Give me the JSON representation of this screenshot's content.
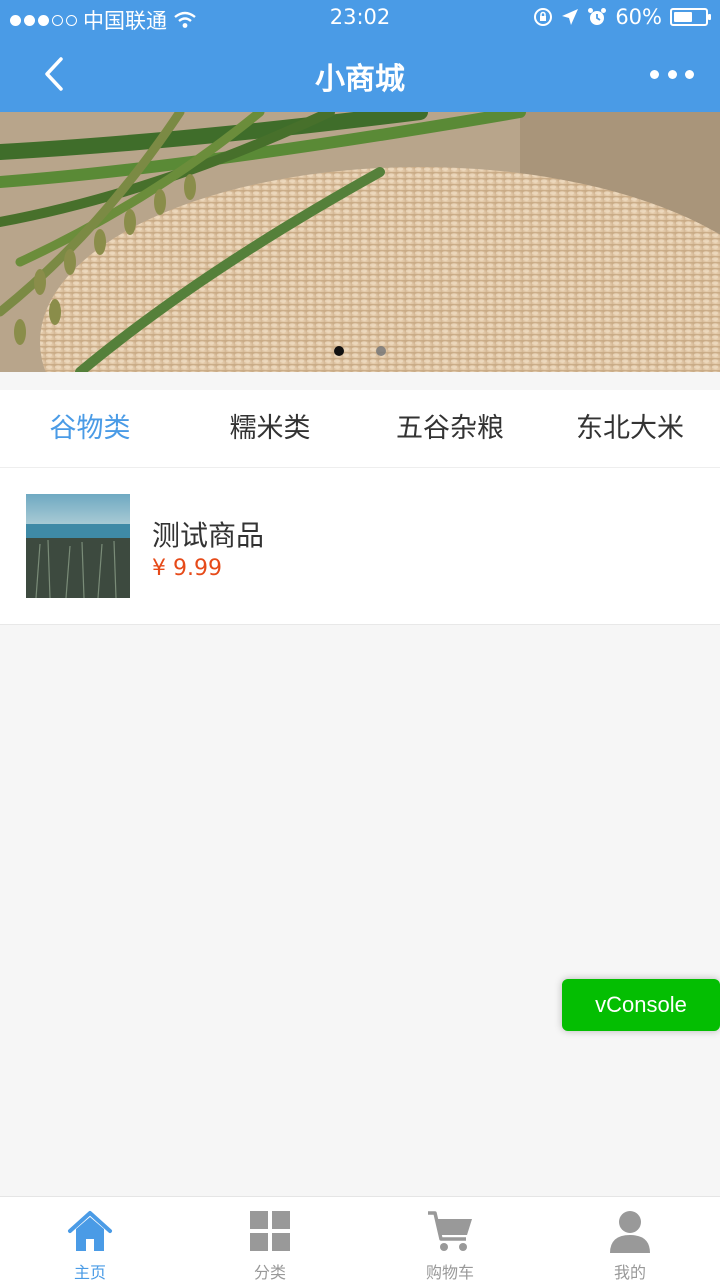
{
  "status_bar": {
    "carrier": "中国联通",
    "time": "23:02",
    "battery": "60%",
    "battery_level": 0.6
  },
  "nav": {
    "title": "小商城",
    "back_icon": "chevron-left-icon",
    "more_icon": "more-dots-icon"
  },
  "banner": {
    "slide_count": 2,
    "active_slide": 1
  },
  "tabs": [
    {
      "label": "谷物类",
      "active": true
    },
    {
      "label": "糯米类",
      "active": false
    },
    {
      "label": "五谷杂粮",
      "active": false
    },
    {
      "label": "东北大米",
      "active": false
    }
  ],
  "products": [
    {
      "name": "测试商品",
      "price": "¥ 9.99"
    }
  ],
  "vconsole": {
    "label": "vConsole"
  },
  "tabbar": [
    {
      "label": "主页",
      "icon": "home-icon",
      "active": true
    },
    {
      "label": "分类",
      "icon": "grid-icon",
      "active": false
    },
    {
      "label": "购物车",
      "icon": "cart-icon",
      "active": false
    },
    {
      "label": "我的",
      "icon": "user-icon",
      "active": false
    }
  ],
  "colors": {
    "primary": "#4a9be6",
    "price": "#e64a19",
    "vconsole": "#04be02"
  }
}
